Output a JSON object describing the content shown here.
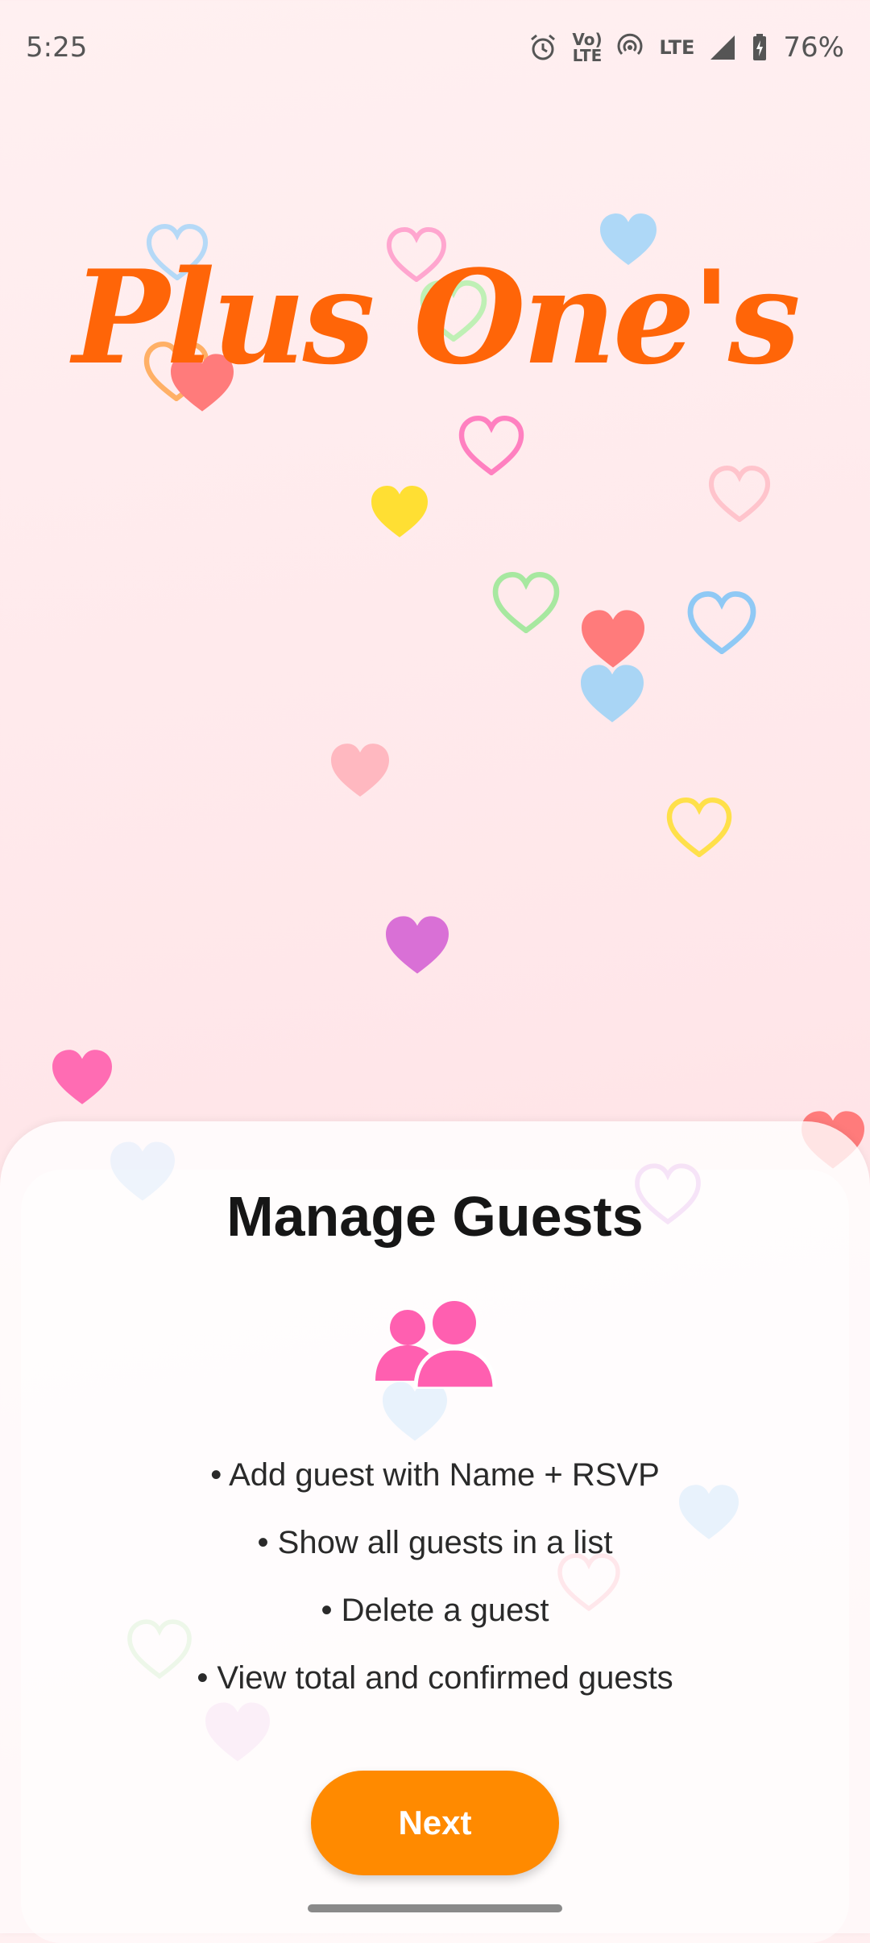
{
  "status_bar": {
    "time": "5:25",
    "battery": "76%",
    "volte_label": "Vo) LTE",
    "lte_label": "LTE"
  },
  "app": {
    "title": "Plus One's"
  },
  "card": {
    "title": "Manage Guests",
    "icon": "people-icon",
    "features": [
      "• Add guest with Name + RSVP",
      "• Show all guests in a list",
      "• Delete a guest",
      "• View total and confirmed guests"
    ],
    "next_label": "Next"
  },
  "colors": {
    "accent": "#ff8a00",
    "title": "#ff6508",
    "icon": "#ff5fb0"
  }
}
